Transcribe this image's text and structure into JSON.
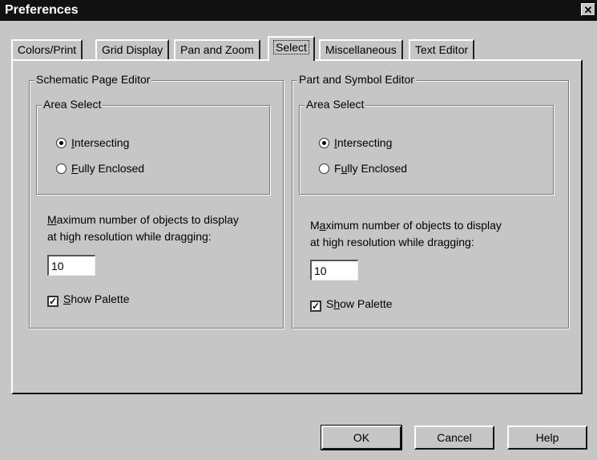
{
  "window": {
    "title": "Preferences",
    "close_glyph": "✕"
  },
  "tabs": [
    {
      "label": "Colors/Print",
      "active": false
    },
    {
      "label": "Grid Display",
      "active": false
    },
    {
      "label": "Pan and Zoom",
      "active": false
    },
    {
      "label": "Select",
      "active": true
    },
    {
      "label": "Miscellaneous",
      "active": false
    },
    {
      "label": "Text Editor",
      "active": false
    }
  ],
  "schematic": {
    "title": "Schematic Page Editor",
    "area_select": {
      "title": "Area Select",
      "options": [
        {
          "mnemonic": "I",
          "rest": "ntersecting",
          "selected": true
        },
        {
          "mnemonic": "F",
          "rest": "ully Enclosed",
          "selected": false
        }
      ]
    },
    "max_label": {
      "line1_mnemonic": "M",
      "line1_rest": "aximum number of objects to display",
      "line2": "at high resolution while dragging:"
    },
    "max_value": "10",
    "show_palette": {
      "mnemonic": "S",
      "rest": "how Palette",
      "checked": true
    }
  },
  "part_symbol": {
    "title": "Part and Symbol Editor",
    "area_select": {
      "title": "Area Select",
      "options": [
        {
          "pre": "",
          "mnemonic": "I",
          "rest": "ntersecting",
          "selected": true
        },
        {
          "pre": "F",
          "mnemonic": "u",
          "rest": "lly Enclosed",
          "selected": false
        }
      ]
    },
    "max_label": {
      "line1_pre": "M",
      "line1_mnemonic": "a",
      "line1_rest": "ximum number of objects to display",
      "line2": "at high resolution while dragging:"
    },
    "max_value": "10",
    "show_palette": {
      "pre": "S",
      "mnemonic": "h",
      "rest": "ow Palette",
      "checked": true
    }
  },
  "buttons": {
    "ok": "OK",
    "cancel": "Cancel",
    "help": "Help"
  }
}
